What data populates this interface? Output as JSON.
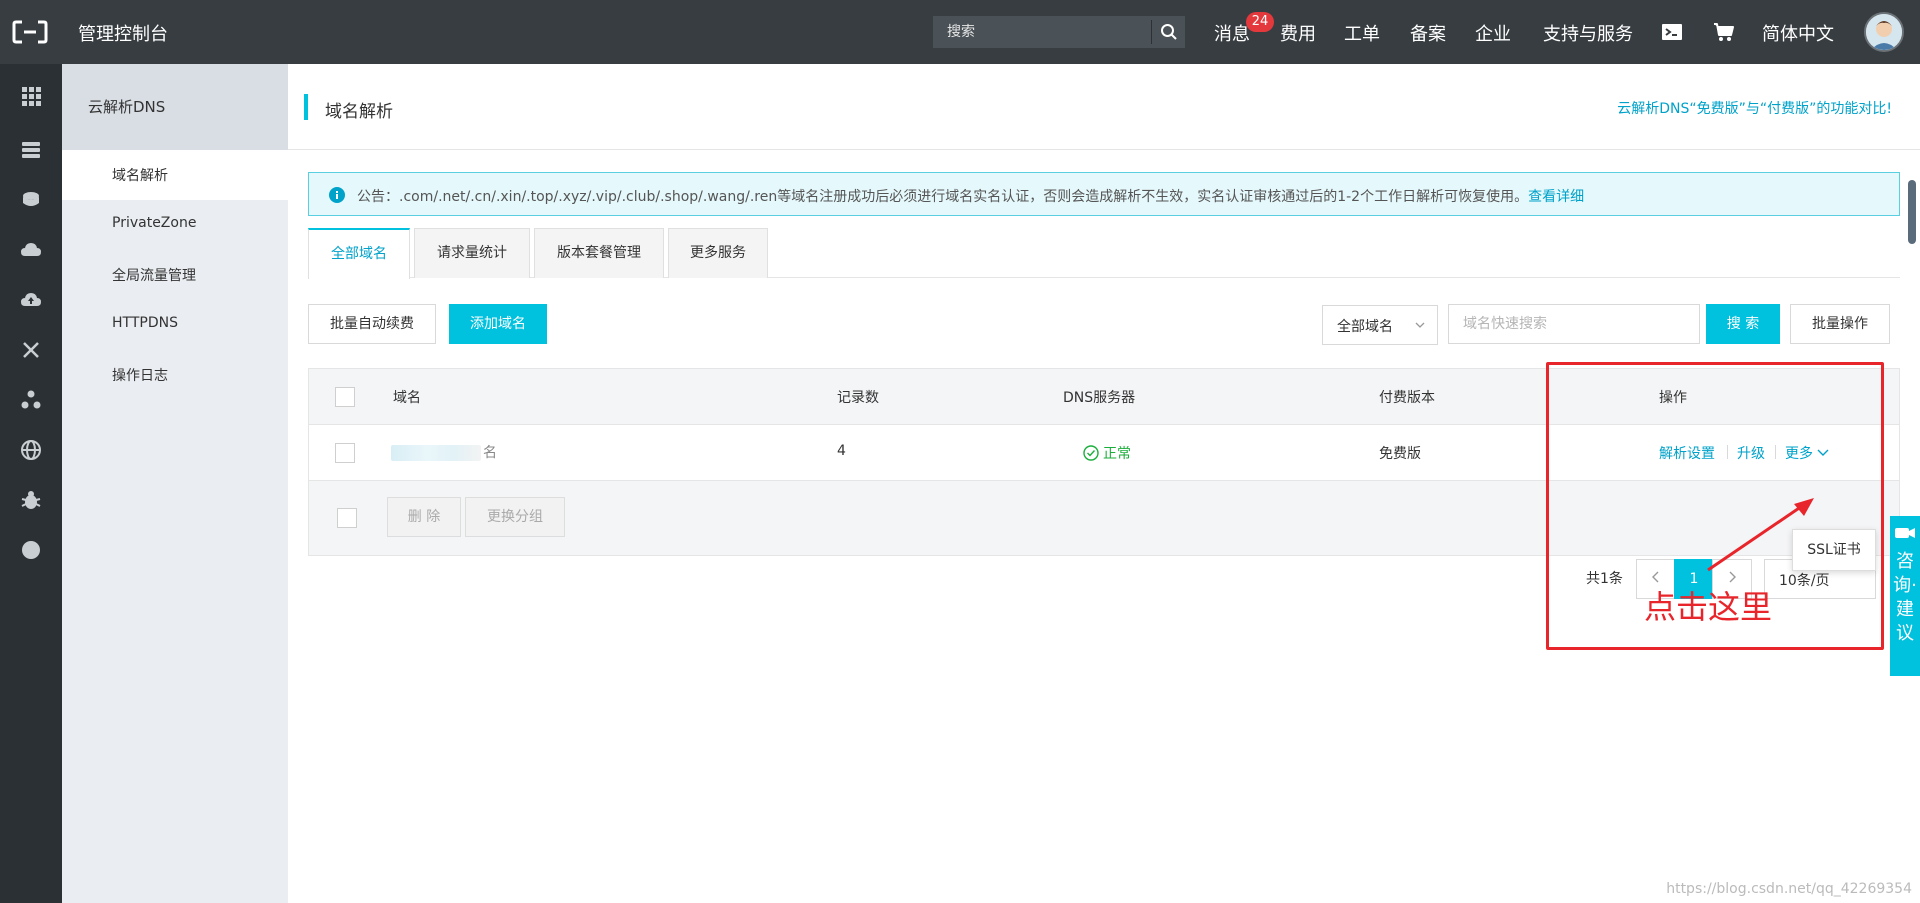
{
  "topbar": {
    "brand": "管理控制台",
    "search_placeholder": "搜索",
    "nav": {
      "messages": "消息",
      "messages_badge": "24",
      "fees": "费用",
      "tickets": "工单",
      "filing": "备案",
      "enterprise": "企业",
      "support": "支持与服务",
      "language": "简体中文"
    }
  },
  "sidebar": {
    "title": "云解析DNS",
    "items": [
      {
        "label": "域名解析",
        "active": true
      },
      {
        "label": "PrivateZone",
        "active": false
      },
      {
        "label": "全局流量管理",
        "active": false
      },
      {
        "label": "HTTPDNS",
        "active": false
      },
      {
        "label": "操作日志",
        "active": false
      }
    ]
  },
  "header": {
    "title": "域名解析",
    "compare_link": "云解析DNS“免费版”与“付费版”的功能对比!"
  },
  "notice": {
    "text": "公告：.com/.net/.cn/.xin/.top/.xyz/.vip/.club/.shop/.wang/.ren等域名注册成功后必须进行域名实名认证，否则会造成解析不生效，实名认证审核通过后的1-2个工作日解析可恢复使用。",
    "link": "查看详细"
  },
  "tabs": [
    "全部域名",
    "请求量统计",
    "版本套餐管理",
    "更多服务"
  ],
  "toolbar": {
    "batch_renew": "批量自动续费",
    "add_domain": "添加域名",
    "filter_select": "全部域名",
    "quick_search_placeholder": "域名快速搜索",
    "search": "搜 索",
    "batch_ops": "批量操作"
  },
  "table": {
    "headers": {
      "domain": "域名",
      "records": "记录数",
      "dns_server": "DNS服务器",
      "plan": "付费版本",
      "ops": "操作"
    },
    "rows": [
      {
        "domain_tail": "名",
        "records": "4",
        "dns_status": "正常",
        "plan": "免费版",
        "ops": {
          "resolve": "解析设置",
          "upgrade": "升级",
          "more": "更多"
        }
      }
    ],
    "footer": {
      "delete": "删 除",
      "change_group": "更换分组",
      "total": "共1条",
      "current_page": "1",
      "page_size": "10条/页"
    }
  },
  "dropdown": {
    "ssl": "SSL证书"
  },
  "annotation": {
    "text": "点击这里",
    "color": "#e8252b"
  },
  "feedback": {
    "text": "咨询·建议"
  },
  "watermark": "https://blog.csdn.net/qq_42269354",
  "colors": {
    "accent": "#00c1de",
    "topbar": "#373d41",
    "status_ok": "#1aae3a"
  }
}
